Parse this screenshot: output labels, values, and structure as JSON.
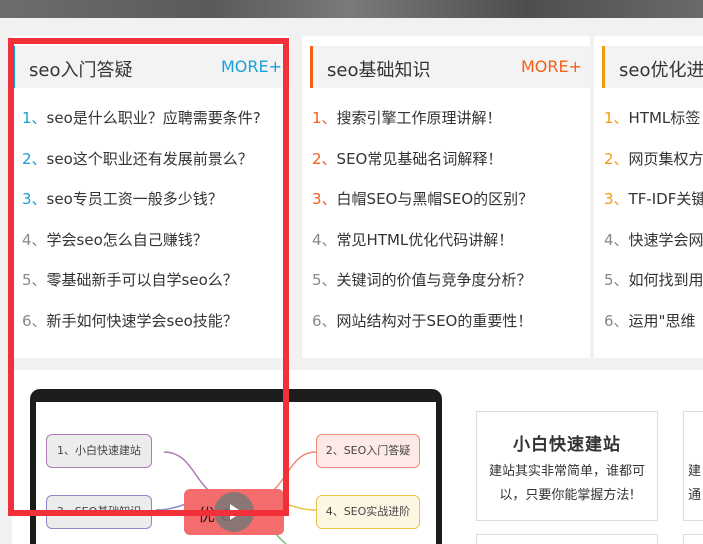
{
  "colors": {
    "blue": "#19a0d8",
    "orange": "#f3601a",
    "amber": "#f39b10",
    "gray_num": "#888888",
    "highlight": "#f2303a"
  },
  "panels": [
    {
      "title": "seo入门答疑",
      "more": "MORE+",
      "items": [
        {
          "num": "1、",
          "text": "seo是什么职业？应聘需要条件?"
        },
        {
          "num": "2、",
          "text": "seo这个职业还有发展前景么？"
        },
        {
          "num": "3、",
          "text": "seo专员工资一般多少钱？"
        },
        {
          "num": "4、",
          "text": "学会seo怎么自己赚钱？"
        },
        {
          "num": "5、",
          "text": "零基础新手可以自学seo么？"
        },
        {
          "num": "6、",
          "text": "新手如何快速学会seo技能？"
        }
      ]
    },
    {
      "title": "seo基础知识",
      "more": "MORE+",
      "items": [
        {
          "num": "1、",
          "text": "搜索引擎工作原理讲解！"
        },
        {
          "num": "2、",
          "text": "SEO常见基础名词解释！"
        },
        {
          "num": "3、",
          "text": "白帽SEO与黑帽SEO的区别？"
        },
        {
          "num": "4、",
          "text": "常见HTML优化代码讲解！"
        },
        {
          "num": "5、",
          "text": "关键词的价值与竞争度分析？"
        },
        {
          "num": "6、",
          "text": "网站结构对于SEO的重要性！"
        }
      ]
    },
    {
      "title": "seo优化进",
      "items": [
        {
          "num": "1、",
          "text": "HTML标签"
        },
        {
          "num": "2、",
          "text": "网页集权方"
        },
        {
          "num": "3、",
          "text": "TF-IDF关键"
        },
        {
          "num": "4、",
          "text": "快速学会网"
        },
        {
          "num": "5、",
          "text": "如何找到用"
        },
        {
          "num": "6、",
          "text": "运用\"思维"
        }
      ]
    }
  ],
  "mindmap": {
    "nodes": [
      "1、小白快速建站",
      "2、SEO入门答疑",
      "3、SEO基础知识",
      "4、SEO实战进阶"
    ],
    "center_partial": "优  O"
  },
  "cards": [
    {
      "title": "小白快速建站",
      "desc": "建站其实非常简单，谁都可以，只要你能掌握方法!"
    },
    {
      "title": "",
      "desc": "建\n通"
    }
  ]
}
